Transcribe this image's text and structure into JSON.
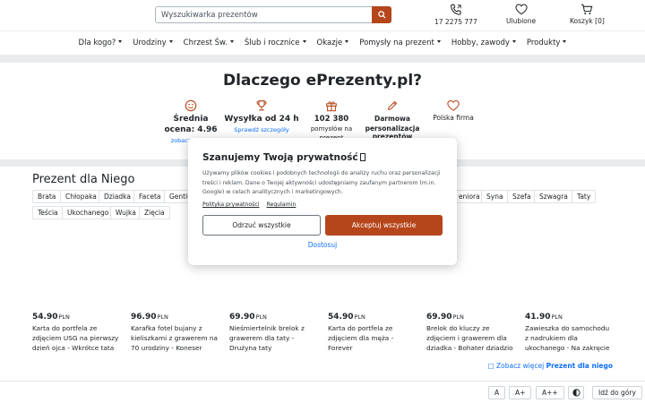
{
  "header": {
    "search": {
      "placeholder": "Wyszukiwarka prezentów"
    },
    "phone": {
      "label": "17 2275 777",
      "icon": "phone-icon"
    },
    "favorites": {
      "label": "Ulubione",
      "icon": "heart-icon"
    },
    "cart": {
      "label": "Koszyk [0]",
      "icon": "cart-icon"
    }
  },
  "nav": {
    "items": [
      {
        "label": "Dla kogo?"
      },
      {
        "label": "Urodziny"
      },
      {
        "label": "Chrzest Św."
      },
      {
        "label": "Ślub i rocznice"
      },
      {
        "label": "Okazje"
      },
      {
        "label": "Pomysły na prezent"
      },
      {
        "label": "Hobby, zawody"
      },
      {
        "label": "Produkty"
      }
    ]
  },
  "why": {
    "title": "Dlaczego ePrezenty.pl?",
    "features": [
      {
        "line1": "Średnia",
        "line2": "ocena: 4.96",
        "link": "zobacz",
        "icon": "smile-icon"
      },
      {
        "line1": "Wysyłka od 24 h",
        "link": "Sprawdź szczegóły",
        "icon": "trophy-icon"
      },
      {
        "line1": "102 380",
        "sub": "pomysłów na prezent",
        "icon": "gift-icon"
      },
      {
        "line1": "Darmowa",
        "line2": "personalizacja",
        "line3": "prezentów",
        "icon": "pencil-icon"
      },
      {
        "plain": "Polska firma",
        "icon": "heart-icon"
      }
    ]
  },
  "gifts_for_him": {
    "title": "Prezent dla Niego",
    "tags_row1": [
      "Brata",
      "Chłopaka",
      "Dziadka",
      "Faceta",
      "Gentle",
      "eniora",
      "Syna",
      "Szefa",
      "Szwagra",
      "Taty"
    ],
    "tags_row2": [
      "Teścia",
      "Ukochanego",
      "Wujka",
      "Zięcia"
    ],
    "more_prefix": "Zobacz więcej",
    "more_link": "Prezent dla niego"
  },
  "products": [
    {
      "price": "54.90",
      "currency": "PLN",
      "name": "Karta do portfela ze zdjęciem USG na pierwszy dzień ojca - Wkrótce tata"
    },
    {
      "price": "96.90",
      "currency": "PLN",
      "name": "Karafka fotel bujany z kieliszkami z grawerem na 70 urodziny - Koneser"
    },
    {
      "price": "69.90",
      "currency": "PLN",
      "name": "Nieśmiertelnik brelok z grawerem dla taty - Drużyna taty"
    },
    {
      "price": "54.90",
      "currency": "PLN",
      "name": "Karta do portfela ze zdjęciem dla męża - Forever"
    },
    {
      "price": "69.90",
      "currency": "PLN",
      "name": "Brelok do kluczy ze zdjęciem i grawerem dla dziadka - Bohater dziadzio"
    },
    {
      "price": "41.90",
      "currency": "PLN",
      "name": "Zawieszka do samochodu z nadrukiem dla ukochanego - Na zakręcie"
    }
  ],
  "accessibility": {
    "font_normal": "A",
    "font_plus": "A+",
    "font_plus2": "A++",
    "contrast_icon": "contrast-icon",
    "to_top": "Idź do góry"
  },
  "cookie_modal": {
    "title": "Szanujemy Twoją prywatność",
    "description": "Używamy plików cookies i podobnych technologii do analizy ruchu oraz personalizacji treści i reklam. Dane o Twojej aktywności udostępniamy zaufanym partnerom (m.in. Google) w celach analitycznych i marketingowych.",
    "link_privacy": "Polityka prywatności",
    "link_rules": "Regulamin",
    "reject_label": "Odrzuć wszystkie",
    "accept_label": "Akceptuj wszystkie",
    "customize_label": "Dostosuj"
  },
  "colors": {
    "brand": "#b5461b",
    "link": "#0d6efd",
    "band": "#e9ecef"
  }
}
